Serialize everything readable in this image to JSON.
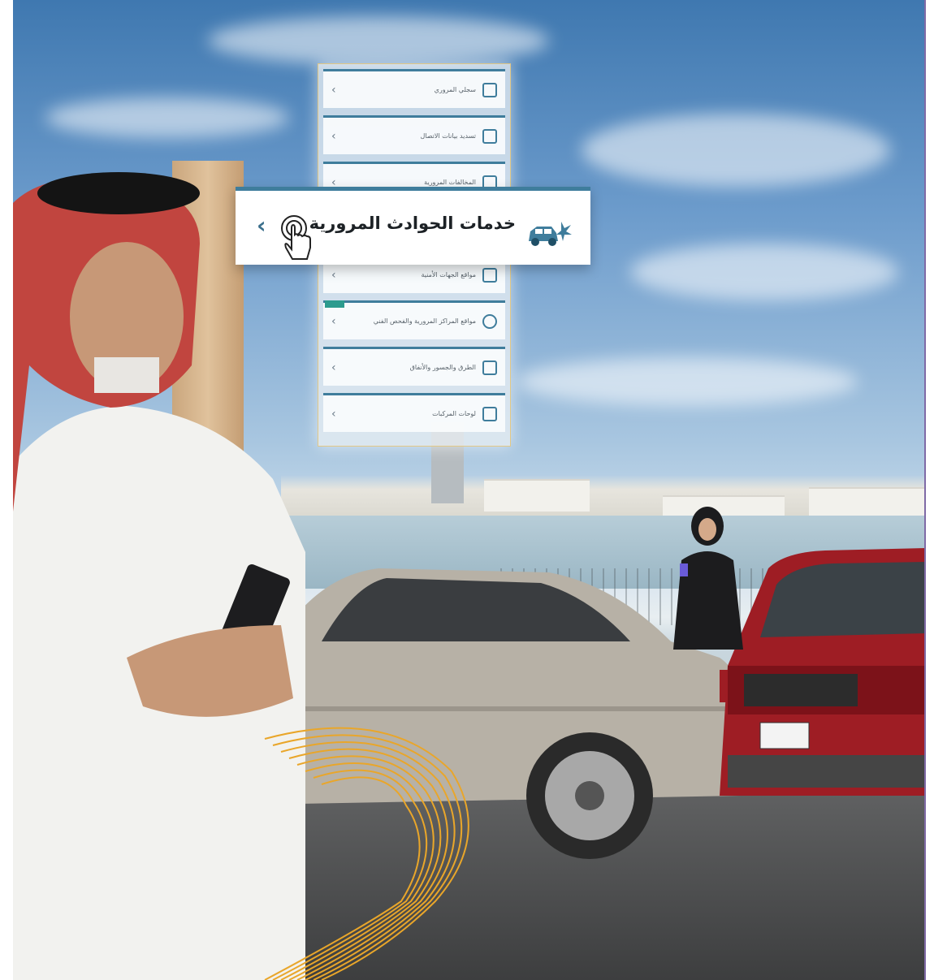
{
  "highlight": {
    "label": "خدمات الحوادث المرورية",
    "chevron": "‹",
    "icon_left": "tap-hand-icon",
    "icon_right": "car-crash-icon"
  },
  "menu": {
    "items": [
      {
        "label": "سجلي المروري",
        "icon": "door-icon"
      },
      {
        "label": "تسديد بيانات الاتصال",
        "icon": "person-card-icon"
      },
      {
        "label": "المخالفات المرورية",
        "icon": "pen-icon"
      },
      {
        "label": "مواقع الجهات الأمنية",
        "icon": "building-icon"
      },
      {
        "label": "مواقع المراكز المرورية والفحص الفني",
        "icon": "location-pin-icon"
      },
      {
        "label": "الطرق والجسور والأنفاق",
        "icon": "road-icon"
      },
      {
        "label": "لوحات المركبات",
        "icon": "plate-icon"
      }
    ],
    "chevron": "‹"
  },
  "colors": {
    "accent": "#3f7d9c",
    "ribbon": "#e9a62a",
    "car_red": "#9e1d24",
    "car_silver": "#a9a397"
  }
}
